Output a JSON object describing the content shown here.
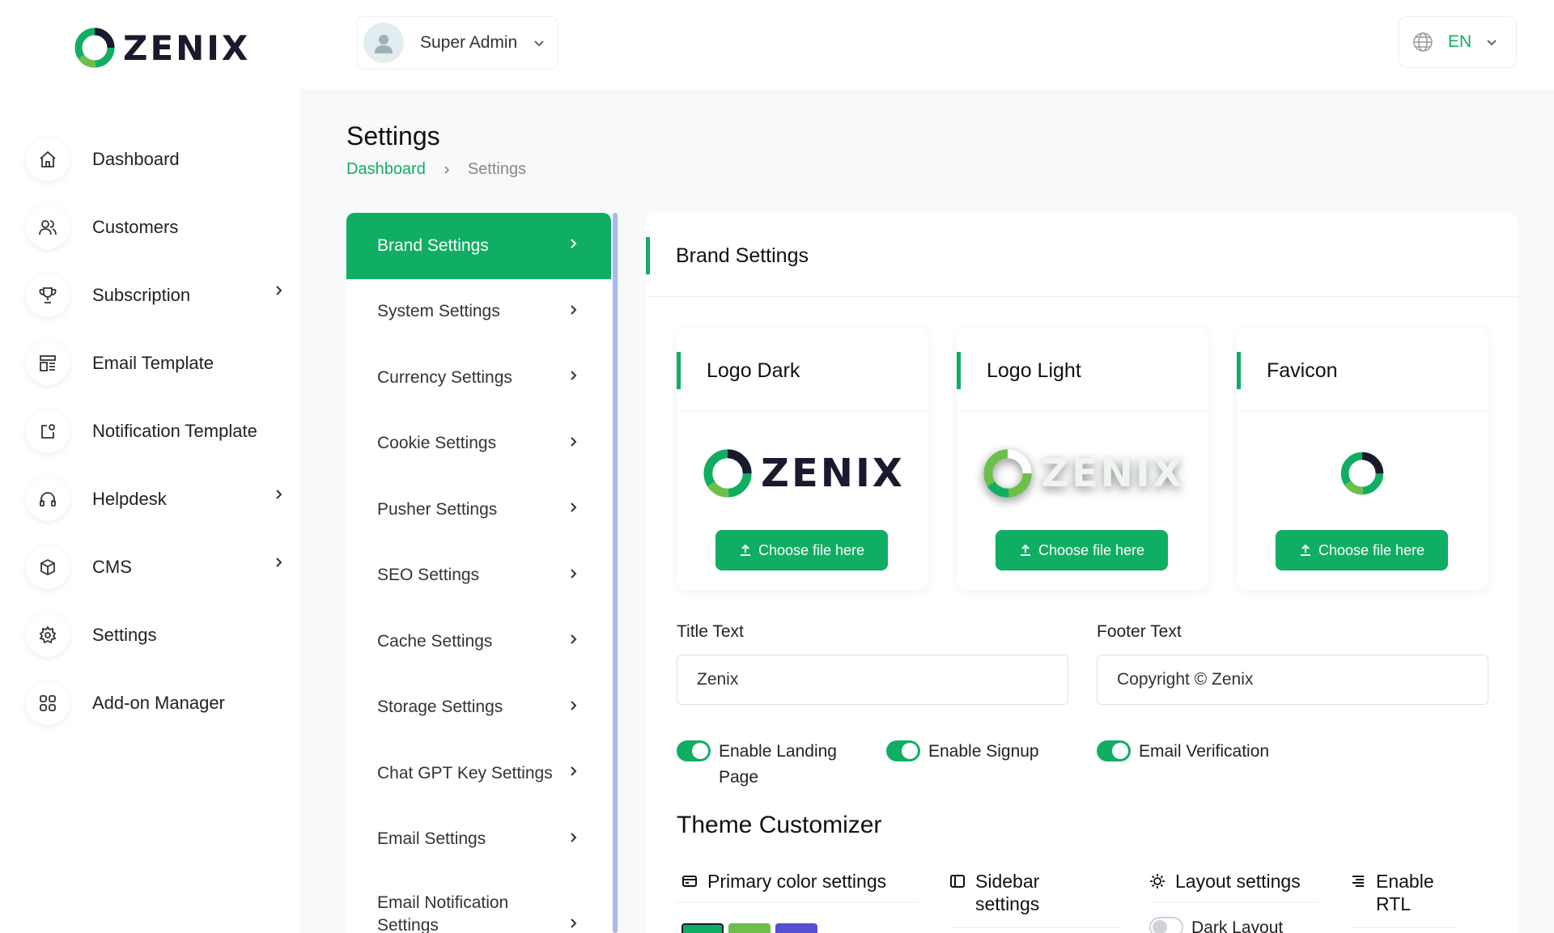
{
  "brand": {
    "name": "ZENIX",
    "logo_icon": "zenix-ring-logo"
  },
  "user": {
    "name": "Super Admin"
  },
  "language": {
    "code": "EN",
    "icon": "globe-icon"
  },
  "sidebar": {
    "items": [
      {
        "label": "Dashboard",
        "icon": "home-icon",
        "has_submenu": false
      },
      {
        "label": "Customers",
        "icon": "users-icon",
        "has_submenu": false
      },
      {
        "label": "Subscription",
        "icon": "trophy-icon",
        "has_submenu": true
      },
      {
        "label": "Email Template",
        "icon": "template-icon",
        "has_submenu": false
      },
      {
        "label": "Notification Template",
        "icon": "notification-icon",
        "has_submenu": false
      },
      {
        "label": "Helpdesk",
        "icon": "headphones-icon",
        "has_submenu": true
      },
      {
        "label": "CMS",
        "icon": "box-icon",
        "has_submenu": true
      },
      {
        "label": "Settings",
        "icon": "gear-icon",
        "has_submenu": false
      },
      {
        "label": "Add-on Manager",
        "icon": "grid-icon",
        "has_submenu": false
      }
    ]
  },
  "page": {
    "title": "Settings",
    "breadcrumb": {
      "home": "Dashboard",
      "current": "Settings"
    }
  },
  "settings_menu": [
    {
      "label": "Brand Settings",
      "active": true
    },
    {
      "label": "System Settings"
    },
    {
      "label": "Currency Settings"
    },
    {
      "label": "Cookie Settings"
    },
    {
      "label": "Pusher Settings"
    },
    {
      "label": "SEO Settings"
    },
    {
      "label": "Cache Settings"
    },
    {
      "label": "Storage Settings"
    },
    {
      "label": "Chat GPT Key Settings"
    },
    {
      "label": "Email Settings"
    },
    {
      "label": "Email Notification Settings"
    }
  ],
  "brand_settings": {
    "heading": "Brand Settings",
    "uploads": [
      {
        "title": "Logo Dark",
        "button": "Choose file here"
      },
      {
        "title": "Logo Light",
        "button": "Choose file here"
      },
      {
        "title": "Favicon",
        "button": "Choose file here"
      }
    ],
    "title_text": {
      "label": "Title Text",
      "value": "Zenix"
    },
    "footer_text": {
      "label": "Footer Text",
      "value": "Copyright © Zenix"
    },
    "toggles": [
      {
        "label": "Enable Landing Page",
        "on": true
      },
      {
        "label": "Enable Signup",
        "on": true
      },
      {
        "label": "Email Verification",
        "on": true
      }
    ]
  },
  "theme_customizer": {
    "title": "Theme Customizer",
    "tabs": [
      {
        "label": "Primary color settings",
        "icon": "card-icon"
      },
      {
        "label": "Sidebar settings",
        "icon": "sidebar-icon"
      },
      {
        "label": "Layout settings",
        "icon": "sun-icon"
      },
      {
        "label": "Enable RTL",
        "icon": "align-right-icon"
      }
    ],
    "dark_layout": {
      "label": "Dark Layout",
      "on": false
    },
    "swatches": [
      "#0fae63",
      "#6cc04a",
      "#584ed2"
    ]
  },
  "colors": {
    "accent": "#0fae63",
    "scrollbar": "#a8b8f0"
  }
}
